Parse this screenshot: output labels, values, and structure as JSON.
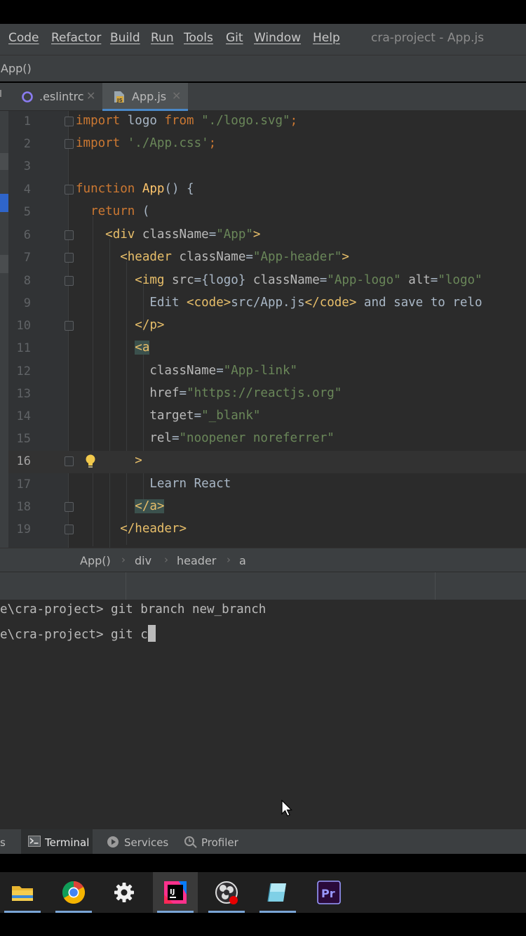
{
  "menubar": {
    "items": [
      "Code",
      "Refactor",
      "Build",
      "Run",
      "Tools",
      "Git",
      "Window",
      "Help"
    ],
    "title": "cra-project - App.js"
  },
  "navbar": {
    "crumb": "App()"
  },
  "tabs": [
    {
      "label": ".eslintrc",
      "icon": "eslint-circle-icon",
      "active": false
    },
    {
      "label": "App.js",
      "icon": "javascript-file-icon",
      "active": true
    }
  ],
  "editor": {
    "current_line": 16,
    "line_numbers": [
      "1",
      "2",
      "3",
      "4",
      "5",
      "6",
      "7",
      "8",
      "9",
      "10",
      "11",
      "12",
      "13",
      "14",
      "15",
      "16",
      "17",
      "18",
      "19"
    ]
  },
  "breadcrumbs": [
    "App()",
    "div",
    "header",
    "a"
  ],
  "terminal": {
    "prompt": "e\\cra-project> ",
    "line1_cmd": "git branch new_branch",
    "line2_cmd": "git c"
  },
  "toolwindows": {
    "truncated": "s",
    "terminal": "Terminal",
    "services": "Services",
    "profiler": "Profiler"
  },
  "taskbar": {
    "apps": [
      "file-explorer-icon",
      "chrome-icon",
      "settings-gear-icon",
      "intellij-idea-icon",
      "obs-recorder-icon",
      "notepad-icon",
      "premiere-pro-icon"
    ],
    "premiere_text": "Pr",
    "ij_text": "IJ"
  },
  "colors": {
    "keyword": "#cc7832",
    "string": "#6a8759",
    "tag": "#e8bf6a",
    "function": "#ffc66d",
    "editor_bg": "#2b2b2b",
    "panel_bg": "#3c3f41"
  }
}
